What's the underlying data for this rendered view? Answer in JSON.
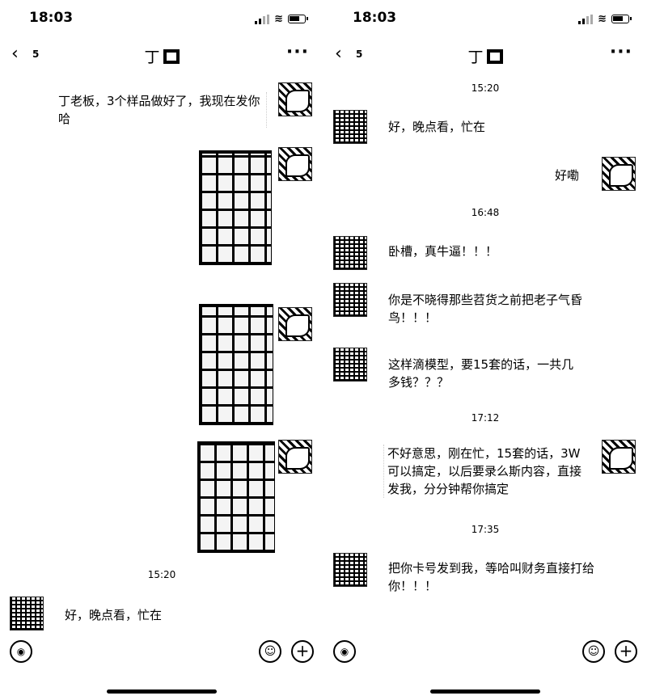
{
  "status": {
    "time": "18:03"
  },
  "nav": {
    "back_count": "5",
    "title": "丁",
    "more": "···"
  },
  "left": {
    "messages": [
      {
        "text": "丁老板，3个样品做好了，我现在发你哈"
      }
    ],
    "timestamp": "15:20",
    "incoming": "好，晚点看，忙在"
  },
  "right": {
    "timestamps": [
      "15:20",
      "16:48",
      "17:12",
      "17:35"
    ],
    "msg1": "好，晚点看，忙在",
    "msg2": "好嘞",
    "msg3": "卧槽，真牛逼！！！",
    "msg4": "你是不晓得那些苕货之前把老子气昏鸟！！！",
    "msg5": "这样滴模型，要15套的话，一共几多钱？？？",
    "msg6": "不好意思，刚在忙，15套的话，3W可以搞定，以后要录么斯内容，直接发我，分分钟帮你搞定",
    "msg7": "把你卡号发到我，等哈叫财务直接打给你！！！"
  },
  "inputbar": {
    "voice": "◉",
    "emoji": "☺",
    "plus": "+"
  }
}
